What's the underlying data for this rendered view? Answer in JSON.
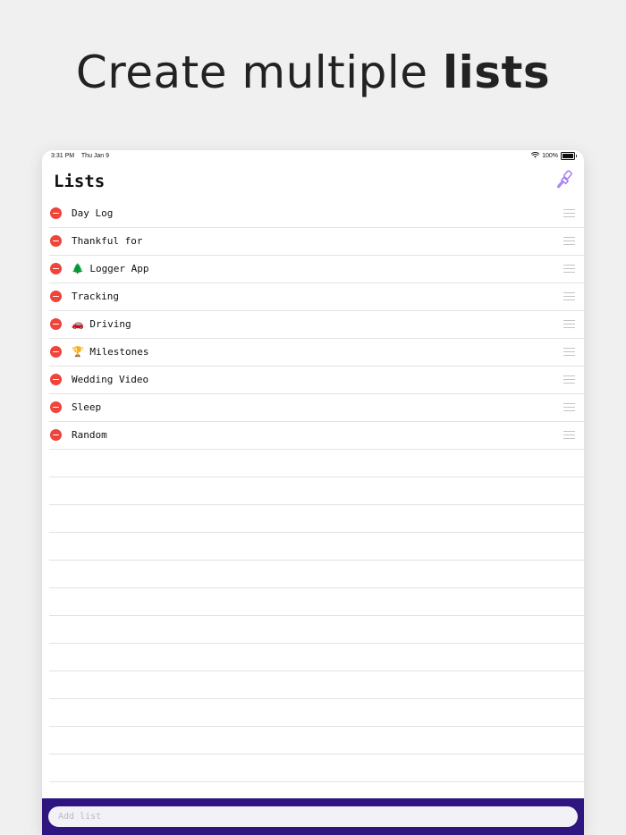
{
  "headline": {
    "light": "Create multiple ",
    "bold": "lists"
  },
  "status_bar": {
    "time": "3:31 PM",
    "date": "Thu Jan 9",
    "battery": "100%",
    "wifi_icon": "wifi-icon",
    "battery_icon": "battery-icon"
  },
  "nav": {
    "title": "Lists",
    "theme_icon": "paintbrush-icon"
  },
  "lists": [
    {
      "label": "Day Log"
    },
    {
      "label": "Thankful for"
    },
    {
      "label": "🌲 Logger App"
    },
    {
      "label": "Tracking"
    },
    {
      "label": "🚗 Driving"
    },
    {
      "label": "🏆 Milestones"
    },
    {
      "label": "Wedding Video"
    },
    {
      "label": "Sleep"
    },
    {
      "label": "Random"
    }
  ],
  "add_list": {
    "placeholder": "Add list",
    "value": ""
  },
  "colors": {
    "accent": "#2e1580",
    "delete": "#f0433a",
    "icon_tint": "#a27cf0"
  }
}
